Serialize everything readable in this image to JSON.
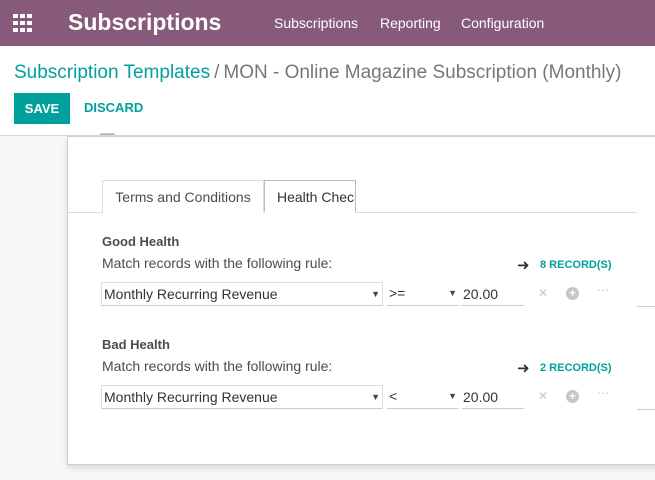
{
  "navbar": {
    "apps_icon": "apps-grid-icon",
    "brand": "Subscriptions",
    "menu": [
      "Subscriptions",
      "Reporting",
      "Configuration"
    ]
  },
  "breadcrumb": {
    "parent": "Subscription Templates",
    "separator": "/",
    "current": "MON - Online Magazine Subscription (Monthly)"
  },
  "actions": {
    "save": "SAVE",
    "discard": "DISCARD"
  },
  "tabs": [
    "Terms and Conditions",
    "Health Check"
  ],
  "good_health": {
    "title": "Good Health",
    "subtitle": "Match records with the following rule:",
    "records": "8 RECORD(S)",
    "field": "Monthly Recurring Revenue",
    "operator": ">=",
    "value": "20.00"
  },
  "bad_health": {
    "title": "Bad Health",
    "subtitle": "Match records with the following rule:",
    "records": "2 RECORD(S)",
    "field": "Monthly Recurring Revenue",
    "operator": "<",
    "value": "20.00"
  },
  "icons": {
    "arrow": "arrow-right-icon",
    "remove": "close-icon",
    "add": "plus-circle-icon",
    "more": "ellipsis-icon"
  },
  "colors": {
    "navbar": "#875a7b",
    "accent": "#00a09d"
  }
}
